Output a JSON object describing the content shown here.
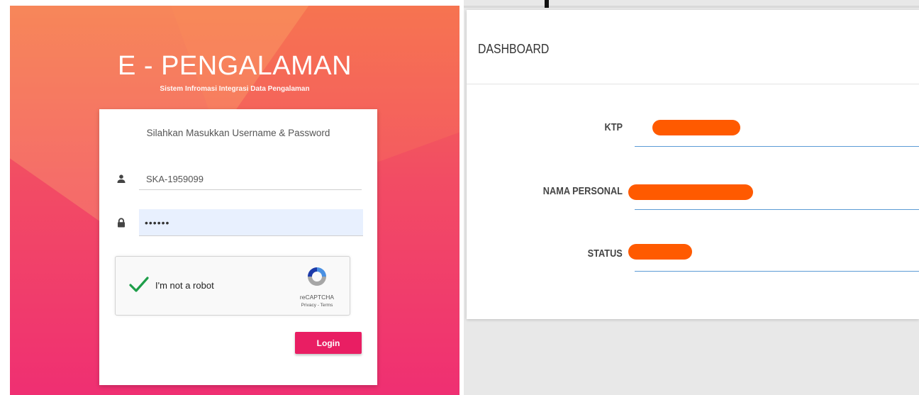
{
  "login": {
    "title": "E - PENGALAMAN",
    "subtitle": "Sistem Infromasi Integrasi Data Pengalaman",
    "card_heading": "Silahkan Masukkan Username & Password",
    "username_value": "SKA-1959099",
    "password_value": "••••••",
    "recaptcha_label": "I'm not a robot",
    "recaptcha_brand": "reCAPTCHA",
    "recaptcha_links": "Privacy - Terms",
    "login_button": "Login",
    "icons": {
      "username": "user-icon",
      "password": "lock-icon",
      "check": "checkmark-icon",
      "recaptcha": "recaptcha-logo-icon"
    },
    "colors": {
      "gradient_top": "#f46d4f",
      "gradient_bottom": "#ef2f72",
      "button": "#e91e63",
      "check": "#1e9e49"
    }
  },
  "dashboard": {
    "title": "DASHBOARD",
    "fields": [
      {
        "label": "KTP"
      },
      {
        "label": "NAMA PERSONAL"
      },
      {
        "label": "STATUS"
      }
    ],
    "colors": {
      "underline": "#5b9bd5",
      "redaction": "#ff5a00"
    }
  }
}
